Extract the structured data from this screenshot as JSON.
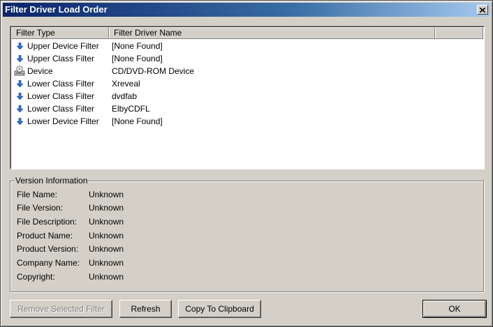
{
  "window": {
    "title": "Filter Driver Load Order"
  },
  "list": {
    "columns": [
      "Filter Type",
      "Filter Driver Name",
      ""
    ],
    "rows": [
      {
        "type": "Upper Device Filter",
        "name": "[None Found]",
        "icon": "down-arrow-icon"
      },
      {
        "type": "Upper Class Filter",
        "name": "[None Found]",
        "icon": "down-arrow-icon"
      },
      {
        "type": "Device",
        "name": "CD/DVD-ROM Device",
        "icon": "cdrom-drive-icon"
      },
      {
        "type": "Lower Class Filter",
        "name": "Xreveal",
        "icon": "down-arrow-icon"
      },
      {
        "type": "Lower Class Filter",
        "name": "dvdfab",
        "icon": "down-arrow-icon"
      },
      {
        "type": "Lower Class Filter",
        "name": "ElbyCDFL",
        "icon": "down-arrow-icon"
      },
      {
        "type": "Lower Device Filter",
        "name": "[None Found]",
        "icon": "down-arrow-icon"
      }
    ]
  },
  "version_info": {
    "legend": "Version Information",
    "fields": [
      {
        "label": "File Name:",
        "value": "Unknown"
      },
      {
        "label": "File Version:",
        "value": "Unknown"
      },
      {
        "label": "File Description:",
        "value": "Unknown"
      },
      {
        "label": "Product Name:",
        "value": "Unknown"
      },
      {
        "label": "Product Version:",
        "value": "Unknown"
      },
      {
        "label": "Company Name:",
        "value": "Unknown"
      },
      {
        "label": "Copyright:",
        "value": "Unknown"
      }
    ]
  },
  "buttons": {
    "remove": "Remove Selected Filter",
    "refresh": "Refresh",
    "copy": "Copy To Clipboard",
    "ok": "OK"
  },
  "colors": {
    "title_bar": "#0a246a",
    "face": "#d4d0c8",
    "arrow": "#2f6fd0"
  }
}
